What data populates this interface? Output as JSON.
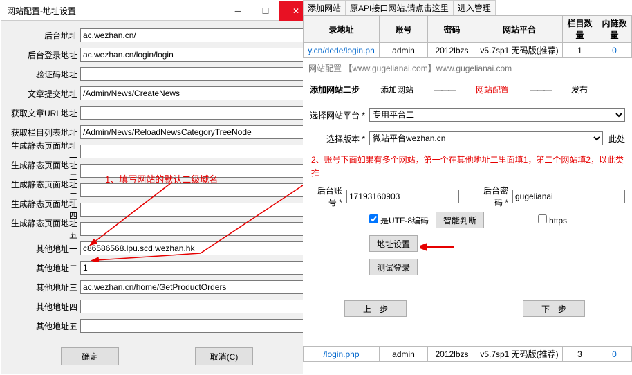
{
  "dialog": {
    "title": "网站配置-地址设置",
    "labels": {
      "backend": "后台地址",
      "login": "后台登录地址",
      "captcha": "验证码地址",
      "article": "文章提交地址",
      "geturl": "获取文章URL地址",
      "getcol": "获取栏目列表地址",
      "gen1": "生成静态页面地址一",
      "gen2": "生成静态页面地址二",
      "gen3": "生成静态页面地址三",
      "gen4": "生成静态页面地址四",
      "gen5": "生成静态页面地址五",
      "o1": "其他地址一",
      "o2": "其他地址二",
      "o3": "其他地址三",
      "o4": "其他地址四",
      "o5": "其他地址五"
    },
    "values": {
      "backend": "ac.wezhan.cn/",
      "login": "ac.wezhan.cn/login/login",
      "captcha": "",
      "article": "/Admin/News/CreateNews",
      "geturl": "",
      "getcol": "/Admin/News/ReloadNewsCategoryTreeNode",
      "gen1": "",
      "gen2": "",
      "gen3": "",
      "gen4": "",
      "gen5": "",
      "o1": "c86586568.lpu.scd.wezhan.hk",
      "o2": "1",
      "o3": "ac.wezhan.cn/home/GetProductOrders",
      "o4": "",
      "o5": ""
    },
    "ok": "确定",
    "cancel": "取消(C)"
  },
  "anno1": "1、填写网站的默认二级域名",
  "right": {
    "tabs": {
      "add": "添加网站",
      "api": "原API接口网站,请点击这里",
      "mgr": "进入管理"
    },
    "th": {
      "login": "录地址",
      "acct": "账号",
      "pwd": "密码",
      "plat": "网站平台",
      "cols": "栏目数量",
      "links": "内链数量"
    },
    "row1": {
      "login": "y.cn/dede/login.ph",
      "acct": "admin",
      "pwd": "2012lbzs",
      "plat": "v5.7sp1 无码版(推荐)",
      "cols": "1",
      "links": "0"
    },
    "subtitle": "网站配置 【www.gugelianai.com】www.gugelianai.com",
    "head": {
      "step": "添加网站二步",
      "add": "添加网站",
      "cfg": "网站配置",
      "pub": "发布"
    },
    "sep": "———",
    "platLbl": "选择网站平台 *",
    "platVal": "专用平台二",
    "verLbl": "选择版本 *",
    "verVal": "微站平台wezhan.cn",
    "verSide": "此处",
    "note": "2、账号下面如果有多个网站，第一个在其他地址二里面填1，第二个网站填2，以此类推",
    "acctLbl": "后台账号 *",
    "acctVal": "17193160903",
    "pwdLbl": "后台密码 *",
    "pwdVal": "gugelianai",
    "utf": "是UTF-8编码",
    "judge": "智能判断",
    "https": "https",
    "addrBtn": "地址设置",
    "testBtn": "测试登录",
    "prev": "上一步",
    "next": "下一步",
    "bot1": {
      "login": "/login.php",
      "acct": "admin",
      "pwd": "2012lbzs",
      "plat": "v5.7sp1 无码版(推荐)",
      "cols": "3",
      "links": "0"
    }
  }
}
